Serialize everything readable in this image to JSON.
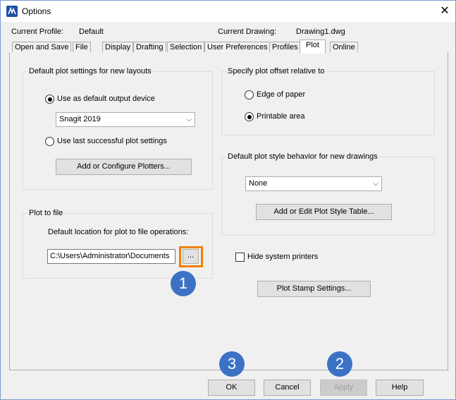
{
  "window": {
    "title": "Options",
    "close_icon": "close-icon"
  },
  "header": {
    "current_profile_label": "Current Profile:",
    "current_profile_value": "Default",
    "current_drawing_label": "Current Drawing:",
    "current_drawing_value": "Drawing1.dwg"
  },
  "tabs": [
    {
      "label": "Open and Save"
    },
    {
      "label": "File"
    },
    {
      "label": "Display"
    },
    {
      "label": "Drafting"
    },
    {
      "label": "Selection"
    },
    {
      "label": "User Preferences"
    },
    {
      "label": "Profiles"
    },
    {
      "label": "Plot",
      "active": true
    },
    {
      "label": "Online"
    }
  ],
  "default_plot": {
    "group_label": "Default plot settings for new layouts",
    "use_default_label": "Use as default output device",
    "device_value": "Snagit 2019",
    "use_last_label": "Use last successful plot settings",
    "add_plotters_label": "Add or Configure Plotters..."
  },
  "plot_to_file": {
    "group_label": "Plot to file",
    "location_label": "Default location for plot to file operations:",
    "path_value": "C:\\Users\\Administrator\\Documents",
    "browse_label": "..."
  },
  "offset": {
    "group_label": "Specify plot offset relative to",
    "edge_label": "Edge of paper",
    "printable_label": "Printable area"
  },
  "plot_style": {
    "group_label": "Default plot style behavior for new drawings",
    "style_value": "None",
    "add_edit_label": "Add or Edit Plot Style Table..."
  },
  "hide_printers_label": "Hide system printers",
  "plot_stamp_label": "Plot Stamp Settings...",
  "footer": {
    "ok": "OK",
    "cancel": "Cancel",
    "apply": "Apply",
    "help": "Help"
  },
  "callouts": {
    "one": "1",
    "two": "2",
    "three": "3"
  },
  "colors": {
    "callout": "#3c72c4",
    "highlight": "#f08000"
  }
}
